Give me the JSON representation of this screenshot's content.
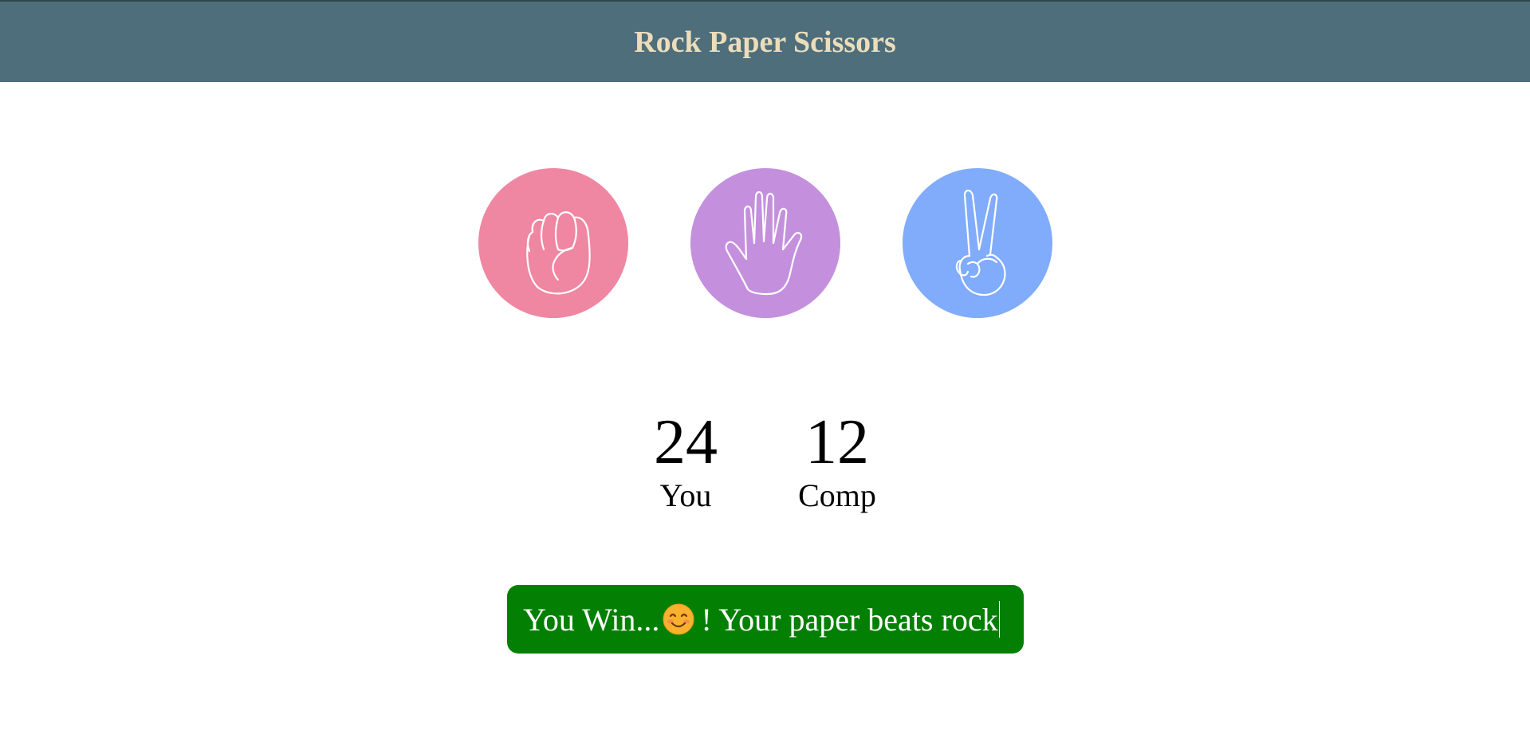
{
  "header": {
    "title": "Rock Paper Scissors"
  },
  "choices": [
    {
      "name": "rock",
      "icon": "rock-fist-icon",
      "color": "#ef86a2"
    },
    {
      "name": "paper",
      "icon": "paper-hand-icon",
      "color": "#c490de"
    },
    {
      "name": "scissors",
      "icon": "scissors-peace-icon",
      "color": "#80acfb"
    }
  ],
  "scores": {
    "user": {
      "value": "24",
      "label": "You"
    },
    "comp": {
      "value": "12",
      "label": "Comp"
    }
  },
  "message": {
    "prefix": "You Win...",
    "emoji": "smiling-face-icon",
    "suffix": " ! Your paper beats rock",
    "bg": "#038003"
  }
}
